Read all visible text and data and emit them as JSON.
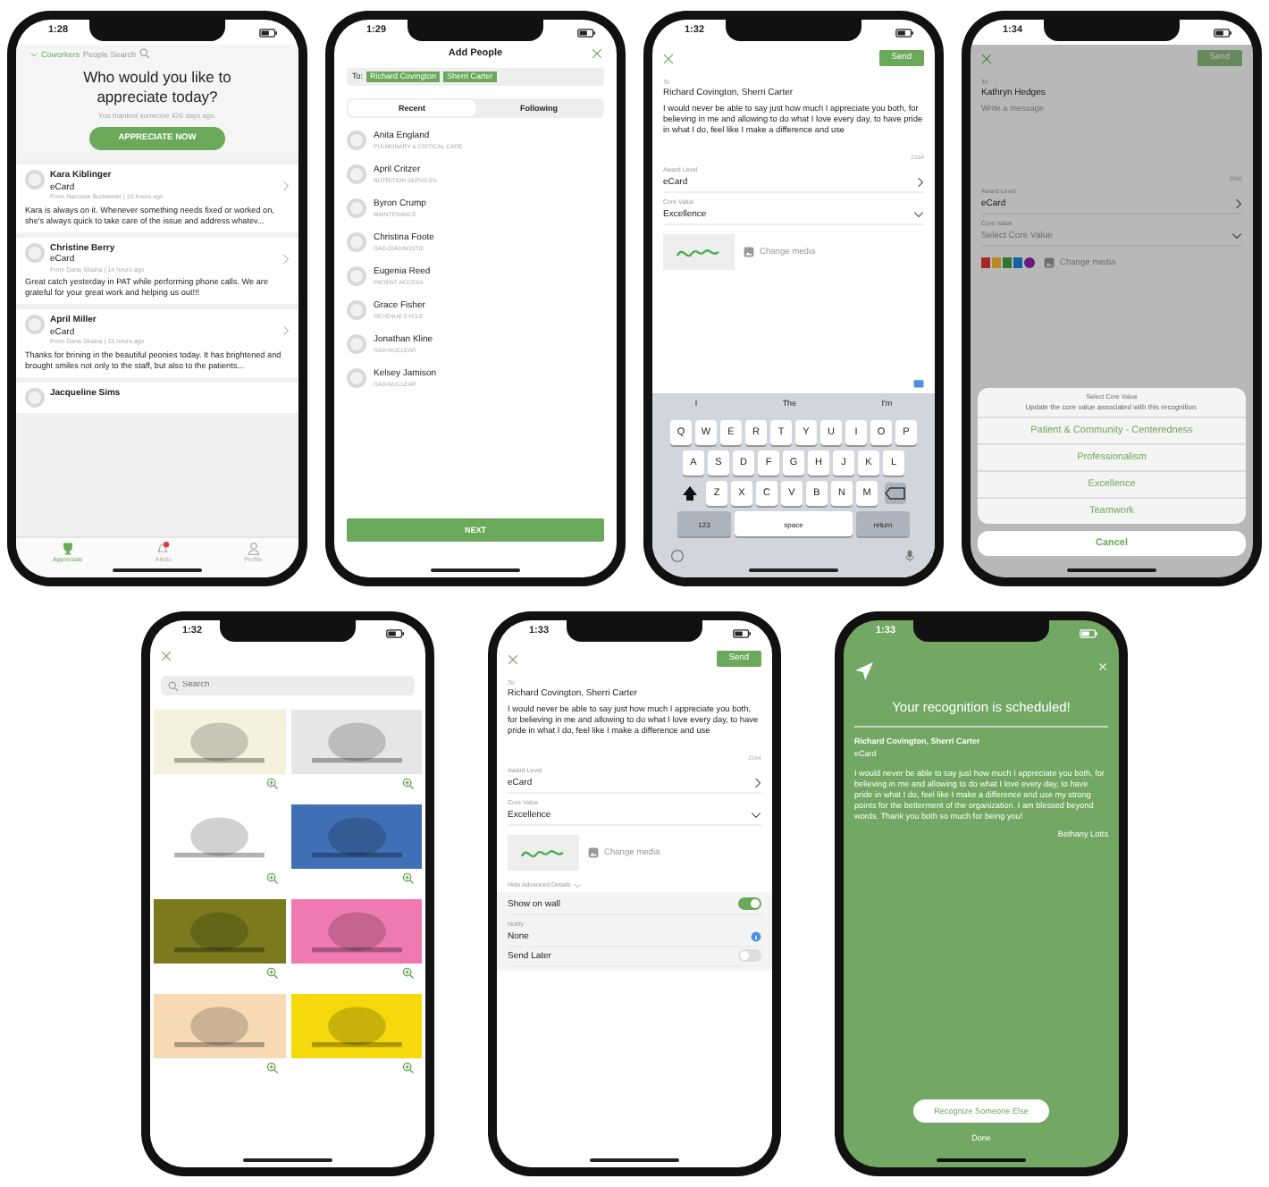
{
  "phones": [
    {
      "kind": "feed",
      "time": "1:28",
      "back": "Coworkers",
      "search": "People Search",
      "heading": "Who would you like to appreciate today?",
      "subheading": "You thanked someone 426 days ago.",
      "action": "APPRECIATE NOW",
      "posts": [
        {
          "name": "Kara Kiblinger",
          "type": "eCard",
          "meta": "From Narcisse Budweiser | 10 hours ago",
          "text": "Kara is always on it. Whenever something needs fixed or worked on, she's always quick to take care of the issue and address whatev..."
        },
        {
          "name": "Christine Berry",
          "type": "eCard",
          "meta": "From Dana Shaina | 14 hours ago",
          "text": "Great catch yesterday in PAT while performing phone calls. We are grateful for your great work and helping us out!!!"
        },
        {
          "name": "April Miller",
          "type": "eCard",
          "meta": "From Dana Shaina | 15 hours ago",
          "text": "Thanks for brining in the beautiful peonies today. It has brightened and brought smiles not only to the staff, but also to the patients..."
        },
        {
          "name": "Jacqueline Sims"
        }
      ],
      "tabs": [
        {
          "label": "Appreciate",
          "selected": true
        },
        {
          "label": "Alerts",
          "selected": false
        },
        {
          "label": "Profile",
          "selected": false
        }
      ]
    },
    {
      "kind": "people",
      "time": "1:29",
      "title": "Add People",
      "to": "To:",
      "recipients": [
        "Richard Covington",
        "Sherri Carter"
      ],
      "segments": [
        {
          "label": "Recent",
          "selected": true
        },
        {
          "label": "Following",
          "selected": false
        }
      ],
      "people": [
        {
          "name": "Anita England",
          "dept": "PULMONARY & CRITICAL CARE"
        },
        {
          "name": "April Critzer",
          "dept": "NUTRITION SERVICES"
        },
        {
          "name": "Byron Crump",
          "dept": "MAINTENANCE"
        },
        {
          "name": "Christina Foote",
          "dept": "RAD-DIAGNOSTIC"
        },
        {
          "name": "Eugenia Reed",
          "dept": "PATIENT ACCESS"
        },
        {
          "name": "Grace Fisher",
          "dept": "REVENUE CYCLE"
        },
        {
          "name": "Jonathan Kline",
          "dept": "RAD-NUCLEAR"
        },
        {
          "name": "Kelsey Jamison",
          "dept": "RAD-NUCLEAR"
        }
      ],
      "action": "NEXT"
    },
    {
      "kind": "compose",
      "time": "1:32",
      "send": "Send",
      "send_disabled": false,
      "to_label": "To",
      "to": "Richard Covington, Sherri Carter",
      "message": "I would never be able to say just how much I appreciate you both, for believing in me and allowing to do what I love every day, to have pride in what I do, feel like I make a difference and use",
      "counter": "2164",
      "award_label": "Award Level",
      "award": "eCard",
      "core_label": "Core Value",
      "core": "Excellence",
      "media": {
        "kind": "card",
        "label": "Change media"
      },
      "keyboard": {
        "suggestions": [
          "I",
          "The",
          "I'm"
        ],
        "rows": [
          [
            "Q",
            "W",
            "E",
            "R",
            "T",
            "Y",
            "U",
            "I",
            "O",
            "P"
          ],
          [
            "A",
            "S",
            "D",
            "F",
            "G",
            "H",
            "J",
            "K",
            "L"
          ],
          [
            "Z",
            "X",
            "C",
            "V",
            "B",
            "N",
            "M"
          ]
        ],
        "numbers": "123",
        "space": "space",
        "return": "return"
      }
    },
    {
      "kind": "compose",
      "time": "1:34",
      "send": "Send",
      "send_disabled": true,
      "to_label": "To",
      "to": "Kathryn Hedges",
      "message_placeholder": "Write a message",
      "counter": "2500",
      "award_label": "Award Level",
      "award": "eCard",
      "core_label": "Core Value",
      "core_placeholder": "Select Core Value",
      "media": {
        "kind": "logos",
        "label": "Change media"
      },
      "sheet": {
        "title": "Select Core Value",
        "subtitle": "Update the core value associated with this recognition.",
        "options": [
          "Patient & Community - Centeredness",
          "Professionalism",
          "Excellence",
          "Teamwork"
        ],
        "cancel": "Cancel"
      }
    },
    {
      "kind": "gallery",
      "time": "1:32",
      "search_placeholder": "Search",
      "cards": [
        {
          "color": "#f4f1dc"
        },
        {
          "color": "#e6e6e6"
        },
        {
          "color": "#ffffff"
        },
        {
          "color": "#3f6fb5"
        },
        {
          "color": "#7d7a1e"
        },
        {
          "color": "#ef7ab2"
        },
        {
          "color": "#f7d9b4"
        },
        {
          "color": "#f5d90c"
        }
      ]
    },
    {
      "kind": "compose",
      "time": "1:33",
      "send": "Send",
      "send_disabled": false,
      "to_label": "To",
      "to": "Richard Covington, Sherri Carter",
      "message": "I would never be able to say just how much I appreciate you both, for believing in me and allowing to do what I love every day, to have pride in what I do, feel like I make a difference and use",
      "counter": "2164",
      "award_label": "Award Level",
      "award": "eCard",
      "core_label": "Core Value",
      "core": "Excellence",
      "media": {
        "kind": "card",
        "label": "Change media"
      },
      "advanced": {
        "toggle": "Hide Advanced Details",
        "show_on_wall": {
          "label": "Show on wall",
          "on": true
        },
        "notify_label": "Notify",
        "notify": "None",
        "send_later": {
          "label": "Send Later",
          "on": false
        }
      }
    },
    {
      "kind": "confirm",
      "time": "1:33",
      "title": "Your recognition is scheduled!",
      "recipients": "Richard Covington, Sherri Carter",
      "type": "eCard",
      "message": "I would never be able to say just how much I appreciate you both, for believing in me and allowing to do what I love every day, to have pride in what I do, feel like I make a difference and use my strong points for the betterment of the organization. I am blessed beyond words. Thank you both so much for being you!",
      "sender": "Bethany Lotts",
      "action": "Recognize Someone Else",
      "done": "Done"
    }
  ]
}
